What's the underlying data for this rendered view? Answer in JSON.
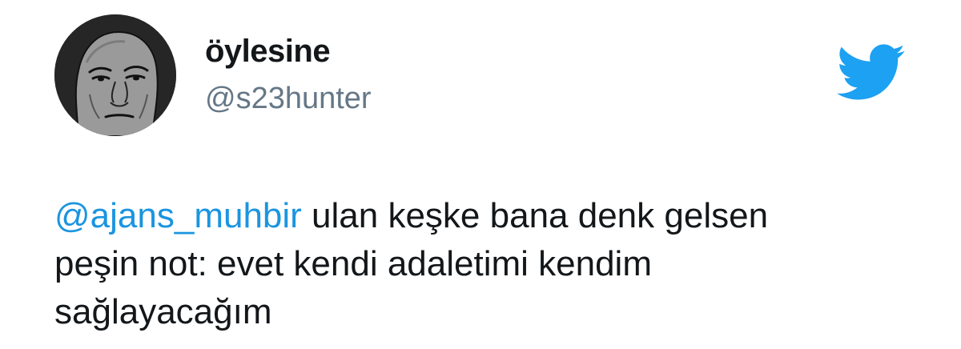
{
  "user": {
    "display_name": "öylesine",
    "handle": "@s23hunter",
    "avatar_icon": "wojak-face-avatar"
  },
  "brand": {
    "icon": "twitter-bird-icon",
    "color": "#1DA1F2"
  },
  "tweet": {
    "mention": "@ajans_muhbir",
    "line1_rest": " ulan keşke bana denk gelsen",
    "line2": "peşin not: evet kendi adaletimi kendim",
    "line3": "sağlayacağım",
    "mention_color": "#1B95E0"
  }
}
